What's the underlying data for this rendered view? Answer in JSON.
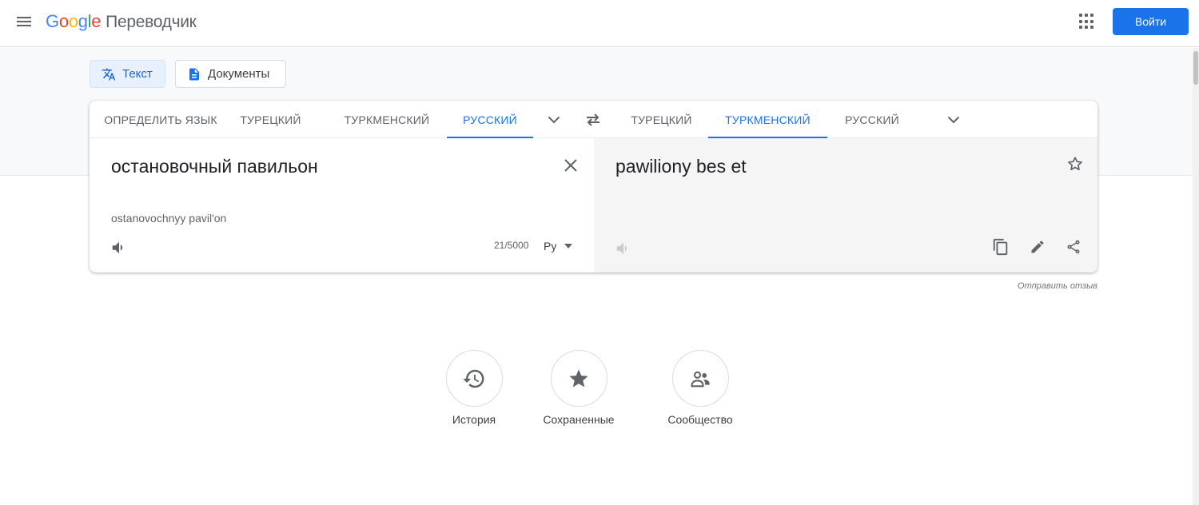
{
  "header": {
    "logo_parts": [
      "G",
      "o",
      "o",
      "g",
      "l",
      "e"
    ],
    "product": "Переводчик",
    "login_label": "Войти"
  },
  "modes": {
    "text_label": "Текст",
    "docs_label": "Документы"
  },
  "source_langs": [
    "ОПРЕДЕЛИТЬ ЯЗЫК",
    "ТУРЕЦКИЙ",
    "ТУРКМЕНСКИЙ",
    "РУССКИЙ"
  ],
  "target_langs": [
    "ТУРЕЦКИЙ",
    "ТУРКМЕНСКИЙ",
    "РУССКИЙ"
  ],
  "active_source": "РУССКИЙ",
  "active_target": "ТУРКМЕНСКИЙ",
  "source": {
    "text": "остановочный павильон",
    "transliteration": "ostanovochnyy pavil'on",
    "counter": "21/5000",
    "keyboard_label": "Рy"
  },
  "target": {
    "text": "pawiliony bes et"
  },
  "feedback_label": "Отправить отзыв",
  "bottom": {
    "history_label": "История",
    "saved_label": "Сохраненные",
    "community_label": "Сообщество"
  },
  "colors": {
    "accent": "#1a73e8",
    "band": "#f8f9fa",
    "target_pane": "#f5f5f5"
  }
}
